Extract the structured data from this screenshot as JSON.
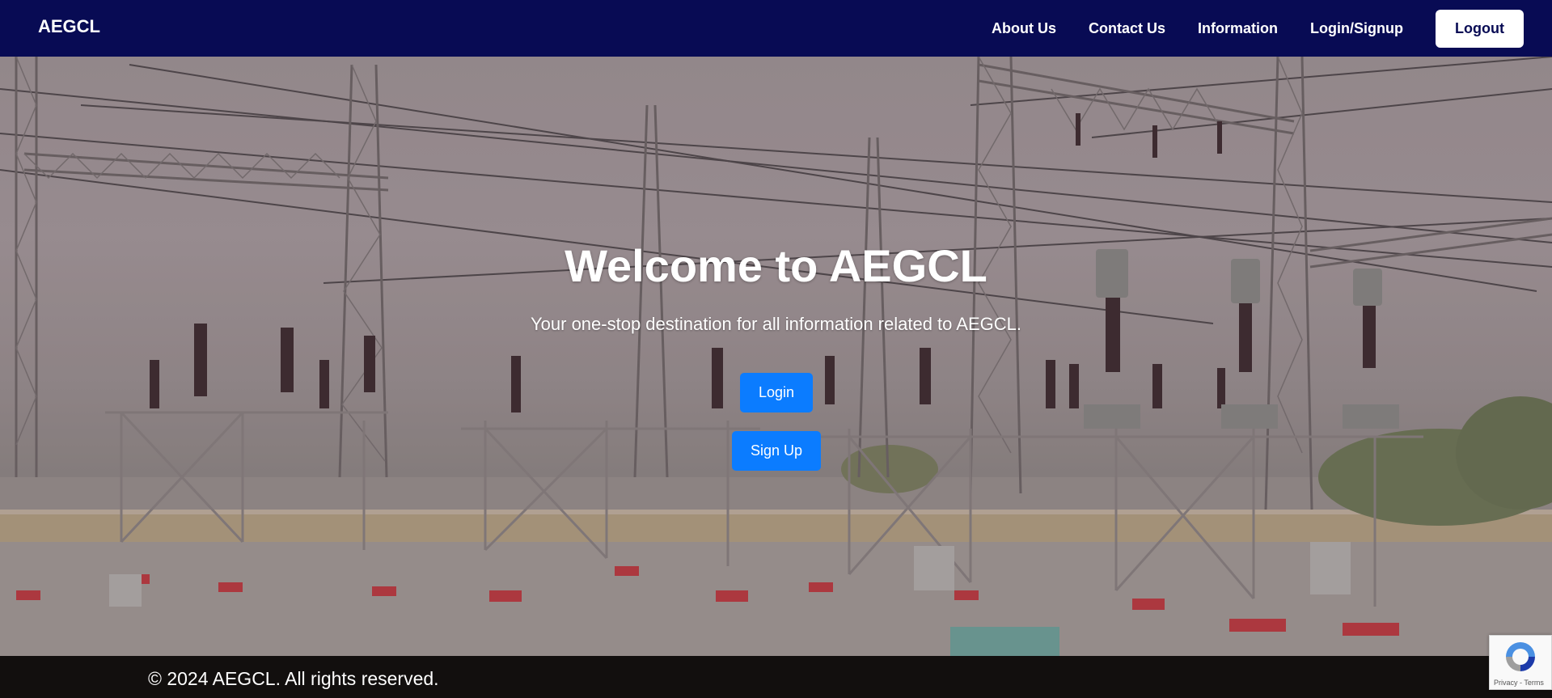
{
  "navbar": {
    "brand": "AEGCL",
    "links": [
      "About Us",
      "Contact Us",
      "Information",
      "Login/Signup"
    ],
    "logout_label": "Logout",
    "background": "#080b54"
  },
  "hero": {
    "title": "Welcome to AEGCL",
    "subtitle": "Your one-stop destination for all information related to AEGCL.",
    "login_label": "Login",
    "signup_label": "Sign Up",
    "button_color": "#0b7cff",
    "background_image": "electrical-substation-photo"
  },
  "footer": {
    "text": "© 2024 AEGCL. All rights reserved."
  },
  "recaptcha": {
    "privacy_label": "Privacy",
    "separator": " - ",
    "terms_label": "Terms"
  }
}
